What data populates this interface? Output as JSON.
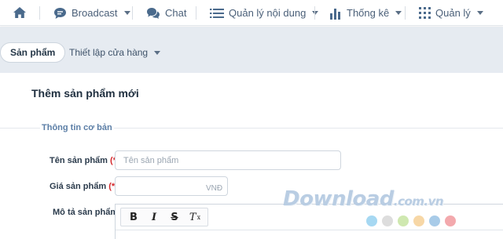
{
  "topnav": {
    "home_icon": "home-icon",
    "items": [
      {
        "label": "Broadcast",
        "icon": "chat-bubble-icon",
        "has_caret": true
      },
      {
        "label": "Chat",
        "icon": "chat-bubbles-icon",
        "has_caret": false
      },
      {
        "label": "Quản lý nội dung",
        "icon": "list-icon",
        "has_caret": true
      },
      {
        "label": "Thống kê",
        "icon": "bar-chart-icon",
        "has_caret": true
      },
      {
        "label": "Quản lý",
        "icon": "grid-icon",
        "has_caret": true
      }
    ]
  },
  "subnav": {
    "active_tab": "Sản phẩm",
    "store_settings": "Thiết lập cửa hàng"
  },
  "main": {
    "page_title": "Thêm sản phẩm mới",
    "section_title": "Thông tin cơ bản",
    "fields": {
      "name": {
        "label": "Tên sản phẩm",
        "required": "(*)",
        "placeholder": "Tên sản phẩm",
        "value": ""
      },
      "price": {
        "label": "Giá sản phẩm",
        "required": "(*)",
        "value": "",
        "unit": "VNĐ"
      },
      "description": {
        "label": "Mô tả sản phẩm"
      }
    },
    "editor_toolbar": {
      "bold": "B",
      "italic": "I",
      "strike": "S",
      "clear_format": "T",
      "clear_format_sub": "x"
    }
  },
  "watermark": {
    "text": "Download",
    "suffix": ".com.vn",
    "dot_colors": [
      "#a6d8f2",
      "#dddddd",
      "#cfe8b0",
      "#f7d7a6",
      "#a8cbe8",
      "#f3a9ad"
    ]
  },
  "colors": {
    "accent": "#5b7ea6",
    "required": "#d3272b",
    "subnav_bg": "#e6ebf1"
  }
}
